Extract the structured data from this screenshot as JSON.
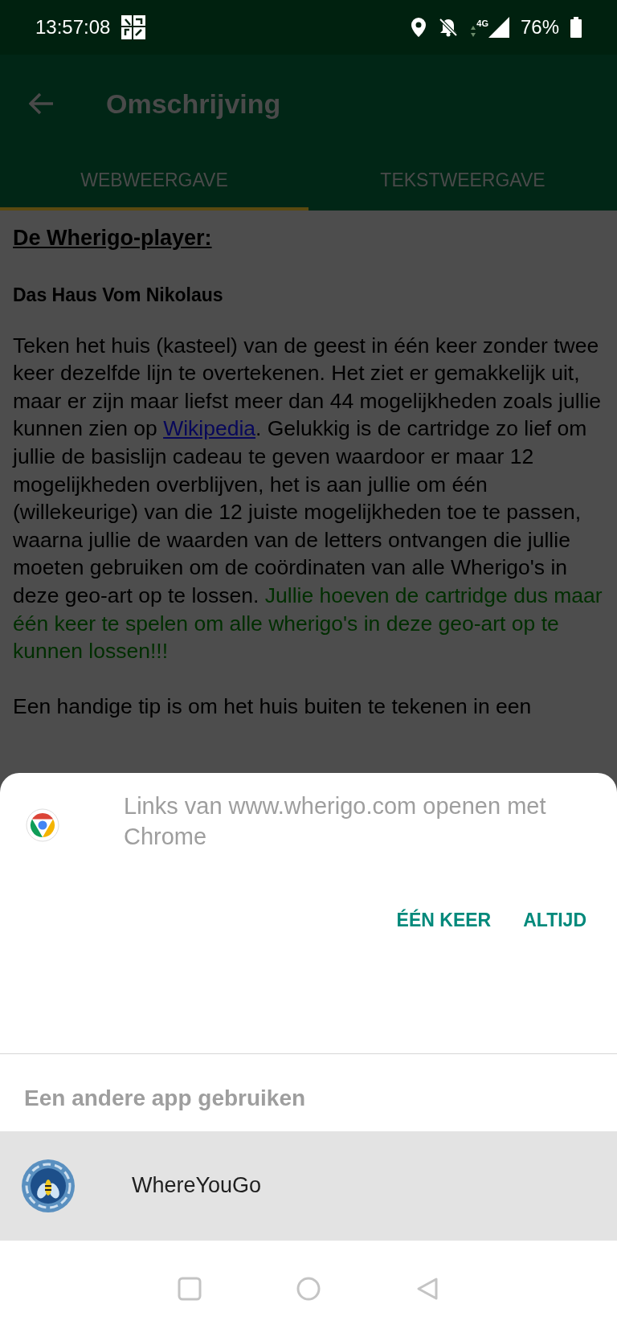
{
  "status_bar": {
    "time": "13:57:08",
    "battery": "76%",
    "network": "4G"
  },
  "app_bar": {
    "title": "Omschrijving"
  },
  "tabs": [
    {
      "label": "WEBWEERGAVE",
      "selected": true
    },
    {
      "label": "TEKSTWEERGAVE",
      "selected": false
    }
  ],
  "content": {
    "heading": "De Wherigo-player:",
    "subheading": "Das Haus Vom Nikolaus",
    "paragraph": {
      "before_link": "Teken het huis (kasteel) van de geest in één keer zonder twee keer dezelfde lijn te overtekenen. Het ziet er gemakkelijk uit, maar er zijn maar liefst meer dan 44 mogelijkheden zoals jullie kunnen zien op ",
      "link": "Wikipedia",
      "after_link": ". Gelukkig is de cartridge zo lief om jullie de basislijn cadeau te geven waardoor er maar 12 mogelijkheden overblijven, het is aan jullie om één (willekeurige) van die 12 juiste mogelijkheden toe te passen, waarna jullie de waarden van de letters ontvangen die jullie moeten gebruiken om de coördinaten van alle Wherigo's in deze geo-art op te lossen. ",
      "highlight": "Jullie hoeven de cartridge dus maar één keer te spelen om alle wherigo's in deze geo-art op te kunnen lossen!!!"
    },
    "tip": "Een handige tip is om het huis buiten te tekenen in een"
  },
  "sheet": {
    "title": "Links van www.wherigo.com openen met Chrome",
    "buttons": [
      "ÉÉN KEER",
      "ALTIJD"
    ],
    "other_label": "Een andere app gebruiken",
    "apps": [
      {
        "name": "WhereYouGo",
        "selected": true
      }
    ]
  }
}
